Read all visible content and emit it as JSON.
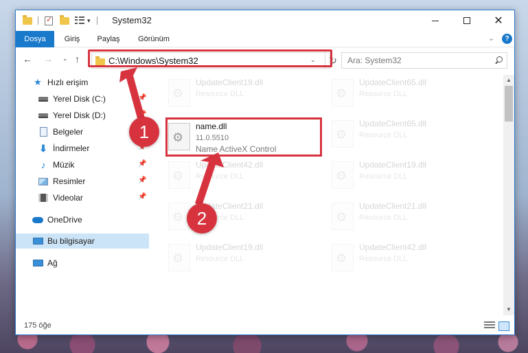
{
  "window": {
    "title": "System32"
  },
  "ribbon": {
    "tabs": [
      "Dosya",
      "Giriş",
      "Paylaş",
      "Görünüm"
    ],
    "help": "?"
  },
  "navigation": {
    "address_path": "C:\\Windows\\System32",
    "search_placeholder": "Ara: System32"
  },
  "sidebar": {
    "items": [
      {
        "label": "Hızlı erişim",
        "icon": "star-icon",
        "pinned": false
      },
      {
        "label": "Yerel Disk (C:)",
        "icon": "drive-icon",
        "pinned": true
      },
      {
        "label": "Yerel Disk (D:)",
        "icon": "drive-icon",
        "pinned": true
      },
      {
        "label": "Belgeler",
        "icon": "documents-icon",
        "pinned": true
      },
      {
        "label": "İndirmeler",
        "icon": "downloads-icon",
        "pinned": true
      },
      {
        "label": "Müzik",
        "icon": "music-icon",
        "pinned": true
      },
      {
        "label": "Resimler",
        "icon": "pictures-icon",
        "pinned": true
      },
      {
        "label": "Videolar",
        "icon": "videos-icon",
        "pinned": true
      },
      {
        "label": "OneDrive",
        "icon": "onedrive-icon",
        "pinned": false
      },
      {
        "label": "Bu bilgisayar",
        "icon": "this-pc-icon",
        "pinned": false,
        "selected": true
      },
      {
        "label": "Ağ",
        "icon": "network-icon",
        "pinned": false
      }
    ]
  },
  "files": {
    "highlighted": {
      "name": "name.dll",
      "version": "11.0.5510",
      "description": "Name ActiveX Control"
    },
    "ghost_left": [
      {
        "name": "UpdateClient19.dll",
        "type": "Resource DLL"
      },
      {
        "name": "UpdateClient42.dll",
        "type": "Resource DLL"
      },
      {
        "name": "UpdateClient21.dll",
        "type": "Resource DLL"
      },
      {
        "name": "UpdateClient19.dll",
        "type": "Resource DLL"
      }
    ],
    "ghost_right": [
      {
        "name": "UpdateClient65.dll",
        "type": "Resource DLL"
      },
      {
        "name": "UpdateClient65.dll",
        "type": "Resource DLL"
      },
      {
        "name": "UpdateClient19.dll",
        "type": "Resource DLL"
      },
      {
        "name": "UpdateClient21.dll",
        "type": "Resource DLL"
      },
      {
        "name": "UpdateClient42.dll",
        "type": "Resource DLL"
      }
    ]
  },
  "statusbar": {
    "count": "175 öğe"
  },
  "annotations": {
    "step1": "1",
    "step2": "2",
    "color": "#d6333f"
  },
  "colors": {
    "accent": "#1979ca",
    "selection": "#cce4f7",
    "highlight": "#d6333f"
  }
}
